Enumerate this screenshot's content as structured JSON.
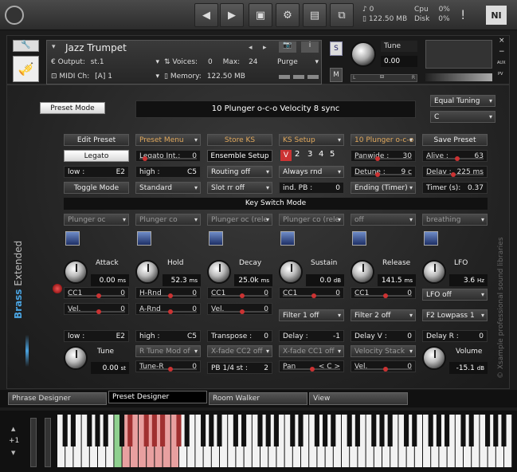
{
  "topbar": {
    "memory_voices": "0",
    "memory_size": "122.50 MB",
    "cpu_label": "Cpu",
    "cpu_value": "0%",
    "disk_label": "Disk",
    "disk_value": "0%",
    "warning": "!"
  },
  "header": {
    "instrument_name": "Jazz Trumpet",
    "output_label": "Output:",
    "output_value": "st.1",
    "midi_label": "MIDI Ch:",
    "midi_value": "[A] 1",
    "voices_label": "Voices:",
    "voices_value": "0",
    "max_label": "Max:",
    "max_value": "24",
    "memory_label": "Memory:",
    "memory_value": "122.50 MB",
    "purge_label": "Purge",
    "s_label": "S",
    "m_label": "M",
    "tune_label": "Tune",
    "tune_value": "0.00",
    "l_label": "L",
    "r_label": "R",
    "aux_label": "AUX",
    "pv_label": "PV"
  },
  "main": {
    "preset_mode_btn": "Preset Mode",
    "display_text": "10 Plunger o-c-o Velocity 8 sync",
    "tuning": "Equal Tuning",
    "key": "C",
    "row1": [
      "Edit Preset",
      "Preset Menu",
      "Store KS",
      "KS Setup",
      "10 Plunger o-c-o Ve",
      "Save Preset"
    ],
    "legato": "Legato",
    "legato_int_label": "Legato Int.:",
    "legato_int_value": "0",
    "ensemble_setup": "Ensemble Setup",
    "ks_v": "V",
    "ks_nums": [
      "2",
      "3",
      "4",
      "5"
    ],
    "panwide_label": "Panwide :",
    "panwide_value": "30",
    "alive_label": "Alive :",
    "alive_value": "63",
    "low_label": "low :",
    "low_value": "E2",
    "high_label": "high :",
    "high_value": "C5",
    "routing": "Routing off",
    "always_rnd": "Always rnd",
    "detune_label": "Detune :",
    "detune_value": "9 c",
    "delay_label": "Delay :",
    "delay_value": "225 ms",
    "toggle_mode": "Toggle Mode",
    "standard": "Standard",
    "slot_rr": "Slot rr off",
    "ind_pb_label": "ind. PB :",
    "ind_pb_value": "0",
    "ending": "Ending (Timer)",
    "timer_label": "Timer (s):",
    "timer_value": "0.37",
    "key_switch_mode": "Key Switch Mode",
    "slots": [
      "Plunger oc",
      "Plunger co",
      "Plunger oc (rele",
      "Plunger co (rele",
      "off",
      "breathing"
    ],
    "env": [
      {
        "name": "Attack",
        "value": "0.00",
        "unit": "ms"
      },
      {
        "name": "Hold",
        "value": "52.3",
        "unit": "ms"
      },
      {
        "name": "Decay",
        "value": "25.0k",
        "unit": "ms"
      },
      {
        "name": "Sustain",
        "value": "0.0",
        "unit": "dB"
      },
      {
        "name": "Release",
        "value": "141.5",
        "unit": "ms"
      },
      {
        "name": "LFO",
        "value": "3.6",
        "unit": "Hz"
      }
    ],
    "cc1_label": "CC1",
    "cc1_values": [
      "0",
      "0",
      "0",
      "0"
    ],
    "vel_label": "Vel.",
    "vel_values": [
      "0",
      "0"
    ],
    "hrnd_label": "H-Rnd",
    "hrnd_value": "0",
    "arnd_label": "A-Rnd",
    "arnd_value": "0",
    "lfo_off": "LFO off",
    "filter1": "Filter 1 off",
    "filter2": "Filter 2 off",
    "f2_lowpass": "F2 Lowpass 1",
    "bottom_low_label": "low :",
    "bottom_low_value": "E2",
    "bottom_high_label": "high :",
    "bottom_high_value": "C5",
    "transpose_label": "Transpose :",
    "transpose_value": "0",
    "delay2_label": "Delay :",
    "delay2_value": "-1",
    "delayv_label": "Delay V :",
    "delayv_value": "0",
    "delayr_label": "Delay R :",
    "delayr_value": "0",
    "tune_label": "Tune",
    "tune_value": "0.00",
    "tune_unit": "st",
    "rtune": "R Tune Mod of",
    "xfade2": "X-fade CC2 off",
    "xfade1": "X-fade CC1 off",
    "velocity_stack": "Velocity Stack",
    "volume_label": "Volume",
    "volume_value": "-15.1",
    "volume_unit": "dB",
    "tuner_label": "Tune-R",
    "tuner_value": "0",
    "pb_label": "PB 1/4 st :",
    "pb_value": "2",
    "pan_label": "Pan",
    "pan_value": "< C >",
    "vel2_label": "Vel.",
    "vel2_value": "0",
    "brass_title": "Brass",
    "brass_sub": "Extended",
    "watermark": "© Xsample professional sound libraries"
  },
  "tabs": [
    "Phrase Designer",
    "Preset Designer",
    "Room Walker",
    "View"
  ],
  "keyboard": {
    "octave": "+1"
  }
}
